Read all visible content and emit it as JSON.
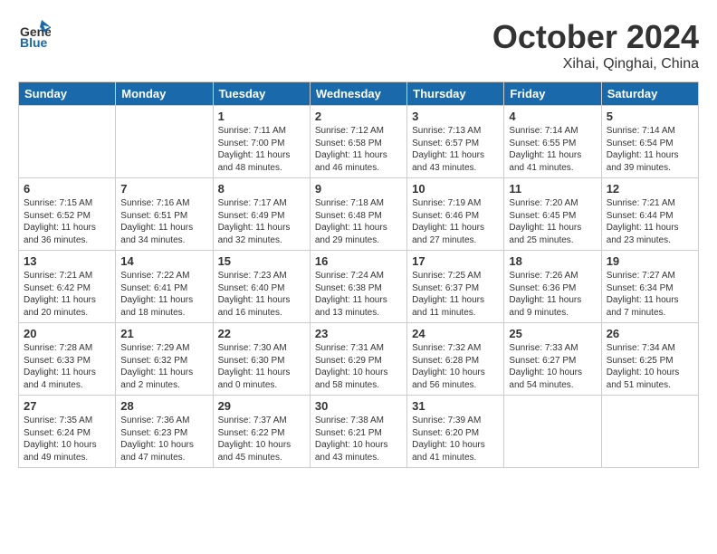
{
  "header": {
    "logo_line1": "General",
    "logo_line2": "Blue",
    "month": "October 2024",
    "location": "Xihai, Qinghai, China"
  },
  "days_of_week": [
    "Sunday",
    "Monday",
    "Tuesday",
    "Wednesday",
    "Thursday",
    "Friday",
    "Saturday"
  ],
  "weeks": [
    [
      {
        "day": "",
        "info": ""
      },
      {
        "day": "",
        "info": ""
      },
      {
        "day": "1",
        "info": "Sunrise: 7:11 AM\nSunset: 7:00 PM\nDaylight: 11 hours\nand 48 minutes."
      },
      {
        "day": "2",
        "info": "Sunrise: 7:12 AM\nSunset: 6:58 PM\nDaylight: 11 hours\nand 46 minutes."
      },
      {
        "day": "3",
        "info": "Sunrise: 7:13 AM\nSunset: 6:57 PM\nDaylight: 11 hours\nand 43 minutes."
      },
      {
        "day": "4",
        "info": "Sunrise: 7:14 AM\nSunset: 6:55 PM\nDaylight: 11 hours\nand 41 minutes."
      },
      {
        "day": "5",
        "info": "Sunrise: 7:14 AM\nSunset: 6:54 PM\nDaylight: 11 hours\nand 39 minutes."
      }
    ],
    [
      {
        "day": "6",
        "info": "Sunrise: 7:15 AM\nSunset: 6:52 PM\nDaylight: 11 hours\nand 36 minutes."
      },
      {
        "day": "7",
        "info": "Sunrise: 7:16 AM\nSunset: 6:51 PM\nDaylight: 11 hours\nand 34 minutes."
      },
      {
        "day": "8",
        "info": "Sunrise: 7:17 AM\nSunset: 6:49 PM\nDaylight: 11 hours\nand 32 minutes."
      },
      {
        "day": "9",
        "info": "Sunrise: 7:18 AM\nSunset: 6:48 PM\nDaylight: 11 hours\nand 29 minutes."
      },
      {
        "day": "10",
        "info": "Sunrise: 7:19 AM\nSunset: 6:46 PM\nDaylight: 11 hours\nand 27 minutes."
      },
      {
        "day": "11",
        "info": "Sunrise: 7:20 AM\nSunset: 6:45 PM\nDaylight: 11 hours\nand 25 minutes."
      },
      {
        "day": "12",
        "info": "Sunrise: 7:21 AM\nSunset: 6:44 PM\nDaylight: 11 hours\nand 23 minutes."
      }
    ],
    [
      {
        "day": "13",
        "info": "Sunrise: 7:21 AM\nSunset: 6:42 PM\nDaylight: 11 hours\nand 20 minutes."
      },
      {
        "day": "14",
        "info": "Sunrise: 7:22 AM\nSunset: 6:41 PM\nDaylight: 11 hours\nand 18 minutes."
      },
      {
        "day": "15",
        "info": "Sunrise: 7:23 AM\nSunset: 6:40 PM\nDaylight: 11 hours\nand 16 minutes."
      },
      {
        "day": "16",
        "info": "Sunrise: 7:24 AM\nSunset: 6:38 PM\nDaylight: 11 hours\nand 13 minutes."
      },
      {
        "day": "17",
        "info": "Sunrise: 7:25 AM\nSunset: 6:37 PM\nDaylight: 11 hours\nand 11 minutes."
      },
      {
        "day": "18",
        "info": "Sunrise: 7:26 AM\nSunset: 6:36 PM\nDaylight: 11 hours\nand 9 minutes."
      },
      {
        "day": "19",
        "info": "Sunrise: 7:27 AM\nSunset: 6:34 PM\nDaylight: 11 hours\nand 7 minutes."
      }
    ],
    [
      {
        "day": "20",
        "info": "Sunrise: 7:28 AM\nSunset: 6:33 PM\nDaylight: 11 hours\nand 4 minutes."
      },
      {
        "day": "21",
        "info": "Sunrise: 7:29 AM\nSunset: 6:32 PM\nDaylight: 11 hours\nand 2 minutes."
      },
      {
        "day": "22",
        "info": "Sunrise: 7:30 AM\nSunset: 6:30 PM\nDaylight: 11 hours\nand 0 minutes."
      },
      {
        "day": "23",
        "info": "Sunrise: 7:31 AM\nSunset: 6:29 PM\nDaylight: 10 hours\nand 58 minutes."
      },
      {
        "day": "24",
        "info": "Sunrise: 7:32 AM\nSunset: 6:28 PM\nDaylight: 10 hours\nand 56 minutes."
      },
      {
        "day": "25",
        "info": "Sunrise: 7:33 AM\nSunset: 6:27 PM\nDaylight: 10 hours\nand 54 minutes."
      },
      {
        "day": "26",
        "info": "Sunrise: 7:34 AM\nSunset: 6:25 PM\nDaylight: 10 hours\nand 51 minutes."
      }
    ],
    [
      {
        "day": "27",
        "info": "Sunrise: 7:35 AM\nSunset: 6:24 PM\nDaylight: 10 hours\nand 49 minutes."
      },
      {
        "day": "28",
        "info": "Sunrise: 7:36 AM\nSunset: 6:23 PM\nDaylight: 10 hours\nand 47 minutes."
      },
      {
        "day": "29",
        "info": "Sunrise: 7:37 AM\nSunset: 6:22 PM\nDaylight: 10 hours\nand 45 minutes."
      },
      {
        "day": "30",
        "info": "Sunrise: 7:38 AM\nSunset: 6:21 PM\nDaylight: 10 hours\nand 43 minutes."
      },
      {
        "day": "31",
        "info": "Sunrise: 7:39 AM\nSunset: 6:20 PM\nDaylight: 10 hours\nand 41 minutes."
      },
      {
        "day": "",
        "info": ""
      },
      {
        "day": "",
        "info": ""
      }
    ]
  ]
}
